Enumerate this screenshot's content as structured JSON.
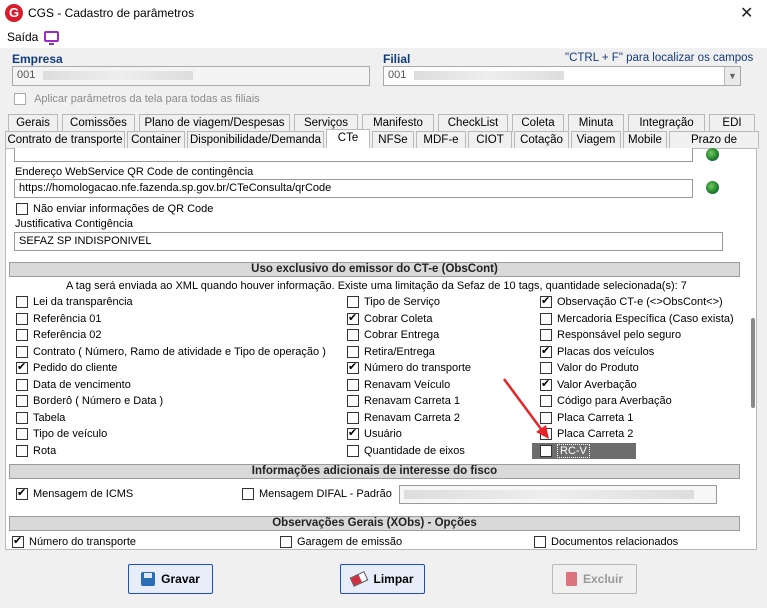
{
  "window": {
    "title": "CGS - Cadastro de parâmetros",
    "app_icon_letter": "G",
    "close_glyph": "✕"
  },
  "menu": {
    "saida": "Saída"
  },
  "empresa": {
    "label": "Empresa",
    "value": "001"
  },
  "filial": {
    "label": "Filial",
    "value": "001",
    "hint": "\"CTRL + F\" para localizar os campos"
  },
  "aplicar_label": "Aplicar parâmetros da tela para todas as filiais",
  "tabs_row1": [
    "Gerais",
    "Comissões",
    "Plano de viagem/Despesas",
    "Serviços",
    "Manifesto",
    "CheckList",
    "Coleta",
    "Minuta",
    "Integração",
    "EDI"
  ],
  "tabs_row2": [
    "Contrato de transporte",
    "Container",
    "Disponibilidade/Demanda",
    "CTe",
    "NFSe",
    "MDF-e",
    "CIOT",
    "Cotação",
    "Viagem",
    "Mobile",
    "Prazo de entrega"
  ],
  "qr": {
    "endereco_label": "Endereço WebService QR Code de contingência",
    "endereco_value": "https://homologacao.nfe.fazenda.sp.gov.br/CTeConsulta/qrCode",
    "nao_enviar_label": "Não enviar informações de QR Code",
    "justificativa_label": "Justificativa Contigência",
    "justificativa_value": "SEFAZ SP INDISPONIVEL"
  },
  "obscont": {
    "header": "Uso exclusivo do emissor do CT-e (ObsCont)",
    "note": "A tag será enviada ao XML quando houver informação. Existe uma limitação da Sefaz de 10 tags, quantidade selecionada(s): 7",
    "col1": [
      {
        "label": "Lei da transparência",
        "checked": false
      },
      {
        "label": "Referência 01",
        "checked": false
      },
      {
        "label": "Referência 02",
        "checked": false
      },
      {
        "label": "Contrato ( Número, Ramo de atividade e Tipo de operação )",
        "checked": false
      },
      {
        "label": "Pedido do cliente",
        "checked": true
      },
      {
        "label": "Data de vencimento",
        "checked": false
      },
      {
        "label": "Borderô ( Número e Data )",
        "checked": false
      },
      {
        "label": "Tabela",
        "checked": false
      },
      {
        "label": "Tipo de veículo",
        "checked": false
      },
      {
        "label": "Rota",
        "checked": false
      }
    ],
    "col2": [
      {
        "label": "Tipo de Serviço",
        "checked": false
      },
      {
        "label": "Cobrar Coleta",
        "checked": true
      },
      {
        "label": "Cobrar Entrega",
        "checked": false
      },
      {
        "label": "Retira/Entrega",
        "checked": false
      },
      {
        "label": "Número do transporte",
        "checked": true
      },
      {
        "label": "Renavam Veículo",
        "checked": false
      },
      {
        "label": "Renavam Carreta 1",
        "checked": false
      },
      {
        "label": "Renavam Carreta 2",
        "checked": false
      },
      {
        "label": "Usuário",
        "checked": true
      },
      {
        "label": "Quantidade de eixos",
        "checked": false
      }
    ],
    "col3": [
      {
        "label": "Observação CT-e (<>ObsCont<>)",
        "checked": true
      },
      {
        "label": "Mercadoria Específica (Caso exista)",
        "checked": false
      },
      {
        "label": "Responsável pelo seguro",
        "checked": false
      },
      {
        "label": "Placas dos veículos",
        "checked": true
      },
      {
        "label": "Valor do Produto",
        "checked": false
      },
      {
        "label": "Valor Averbação",
        "checked": true
      },
      {
        "label": "Código para Averbação",
        "checked": false
      },
      {
        "label": "Placa Carreta 1",
        "checked": false
      },
      {
        "label": "Placa Carreta 2",
        "checked": false
      },
      {
        "label": "RC-V",
        "checked": false
      }
    ]
  },
  "fisco": {
    "header": "Informações adicionais de interesse do fisco",
    "icms_label": "Mensagem de ICMS",
    "icms_checked": true,
    "difal_label": "Mensagem DIFAL - Padrão",
    "difal_checked": false
  },
  "xobs": {
    "header": "Observações Gerais (XObs) - Opções",
    "items": [
      {
        "label": "Número do transporte",
        "checked": true
      },
      {
        "label": "Garagem de emissão",
        "checked": false
      },
      {
        "label": "Documentos relacionados",
        "checked": false
      }
    ]
  },
  "buttons": {
    "gravar": "Gravar",
    "limpar": "Limpar",
    "excluir": "Excluir"
  },
  "colors": {
    "accent": "#1f4fbf",
    "label_blue": "#143b7a",
    "arrow": "#e3262a",
    "brand_red": "#d71c2b"
  }
}
